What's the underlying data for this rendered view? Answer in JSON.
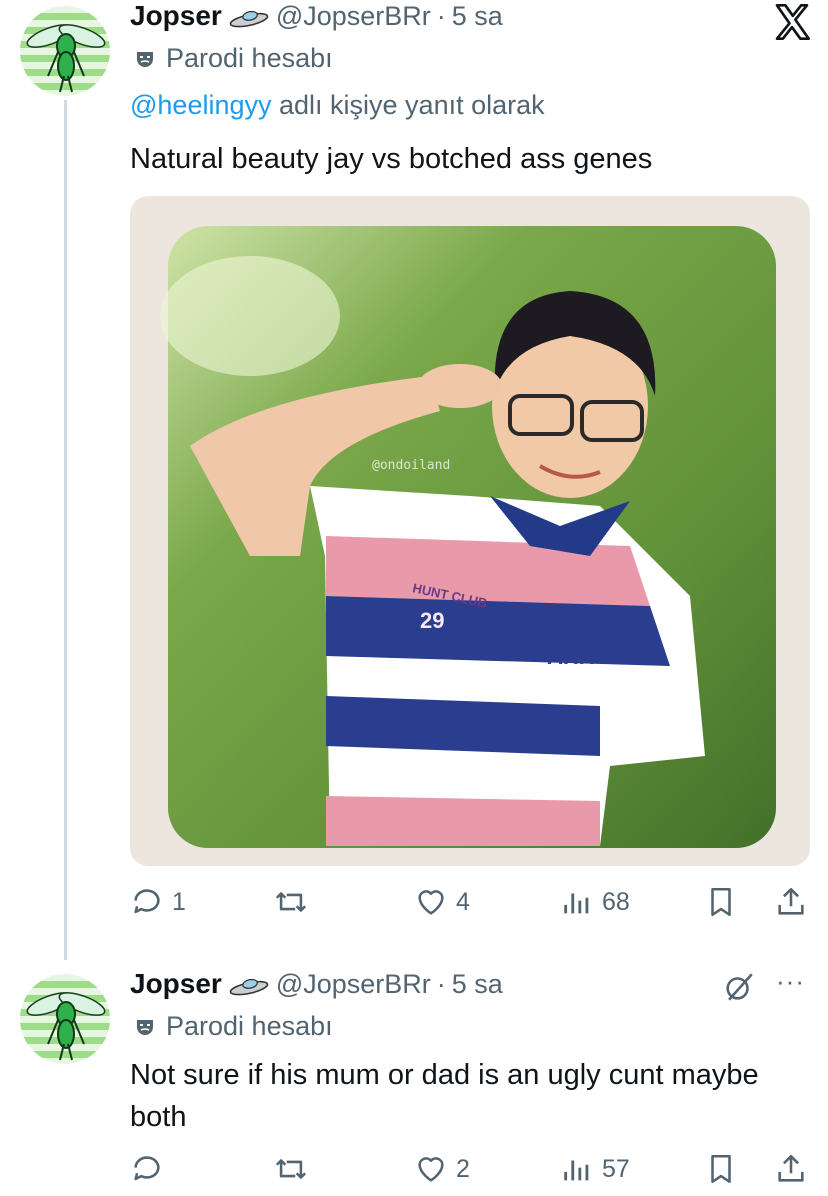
{
  "tweets": [
    {
      "name": "Jopser",
      "handle": "@JopserBRr",
      "time_sep": "·",
      "time": "5 sa",
      "parody_label": "Parodi hesabı",
      "reply_mention": "@heelingyy",
      "reply_suffix": " adlı kişiye yanıt olarak",
      "text": "Natural beauty jay vs botched ass genes",
      "media_watermark": "@ondoiland",
      "media_shirt_text": "HUNT CLUB",
      "media_shirt_number": "29",
      "media_logo_text": "AHK",
      "actions": {
        "replies": "1",
        "reposts": "",
        "likes": "4",
        "views": "68"
      }
    },
    {
      "name": "Jopser",
      "handle": "@JopserBRr",
      "time_sep": "·",
      "time": "5 sa",
      "parody_label": "Parodi hesabı",
      "text": "Not sure if his mum or dad is an ugly cunt maybe both",
      "actions": {
        "replies": "",
        "reposts": "",
        "likes": "2",
        "views": "57"
      }
    }
  ],
  "icons": {
    "close": "x-logo-icon",
    "more": "more-dots-icon",
    "grok": "grok-icon",
    "parody": "theater-mask-icon",
    "name_badge": "ufo-icon",
    "reply": "reply-icon",
    "repost": "repost-icon",
    "like": "heart-icon",
    "views": "views-icon",
    "bookmark": "bookmark-icon",
    "share": "share-icon"
  },
  "colors": {
    "text": "#0f1419",
    "muted": "#536471",
    "link": "#1d9bf0",
    "line": "#cfd9de"
  }
}
